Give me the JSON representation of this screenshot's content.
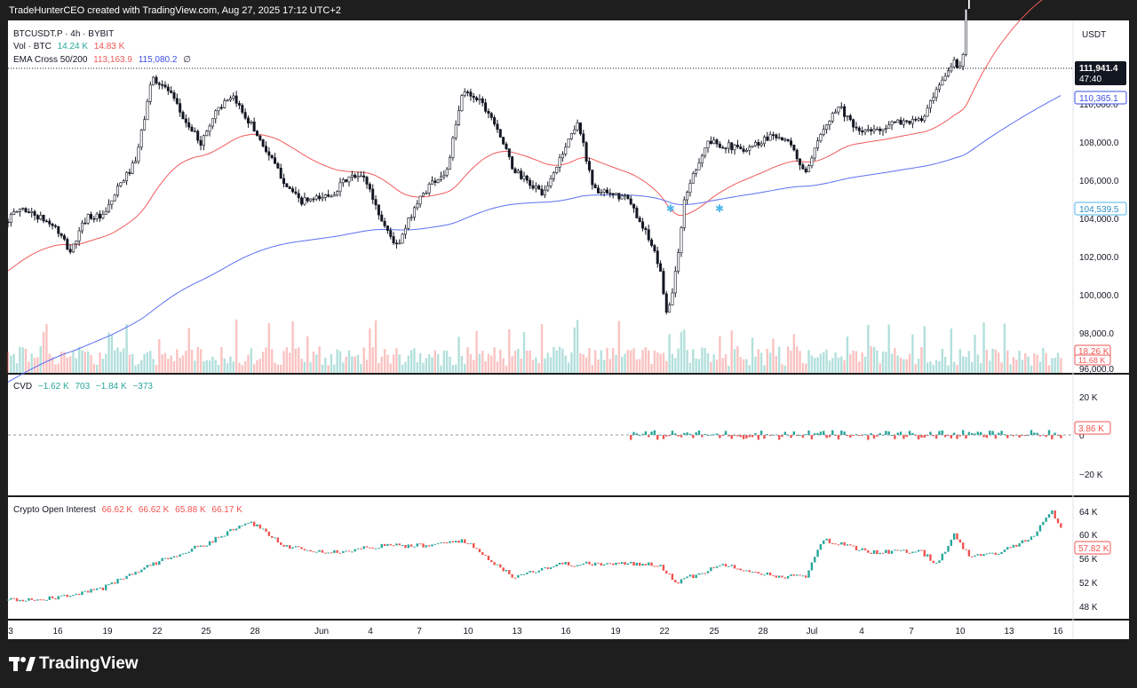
{
  "header": {
    "credit": "TradeHunterCEO created with TradingView.com, Aug 27, 2025 17:12 UTC+2"
  },
  "brand": {
    "name": "TradingView",
    "icon": "tradingview-logo-icon"
  },
  "legend": {
    "symbol": "BTCUSDT.P · 4h · BYBIT",
    "vol_label": "Vol · BTC",
    "vol_val1": "14.24 K",
    "vol_val2": "14.83 K",
    "ema_label": "EMA Cross 50/200",
    "ema_val1": "113,163.9",
    "ema_val2": "115,080.2",
    "ema_suffix": "∅",
    "cvd_label": "CVD",
    "cvd_vals": [
      "−1.62 K",
      "703",
      "−1.84 K",
      "−373"
    ],
    "oi_label": "Crypto Open Interest",
    "oi_vals": [
      "66.62 K",
      "66.62 K",
      "65.88 K",
      "66.17 K"
    ]
  },
  "axis": {
    "currency": "USDT",
    "price_ticks": [
      "110,000.0",
      "108,000.0",
      "106,000.0",
      "104,000.0",
      "102,000.0",
      "100,000.0",
      "98,000.0",
      "96,000.0"
    ],
    "cvd_ticks": [
      "20 K",
      "0",
      "−20 K"
    ],
    "oi_ticks": [
      "64 K",
      "60 K",
      "56 K",
      "52 K",
      "48 K"
    ],
    "date_ticks": [
      "3",
      "16",
      "19",
      "22",
      "25",
      "28",
      "Jun",
      "4",
      "7",
      "10",
      "13",
      "16",
      "19",
      "22",
      "25",
      "28",
      "Jul",
      "4",
      "7",
      "10",
      "13",
      "16"
    ],
    "labels": {
      "last_price": "111,941.4",
      "countdown": "47:40",
      "ema_fast": "110,365.1",
      "ema_slow": "104,539.5",
      "volume": "18.26 K",
      "volume_ma": "11.68 K",
      "cvd": "3.86 K",
      "oi": "57.82 K"
    }
  },
  "colors": {
    "up": "#26a69a",
    "down": "#ef5350",
    "ema_fast": "#f05a5a",
    "ema_slow": "#5b6ff2",
    "cross": "#4fb6e8",
    "candle": "#131722",
    "last_price_bg": "#131722"
  },
  "chart_data": [
    {
      "type": "candlestick",
      "title": "BTCUSDT.P · 4h · BYBIT",
      "ylim": [
        96000,
        113500
      ],
      "x_start": "May 13, 2025",
      "x_end": "Jul 17, 2025",
      "anchors": [
        [
          "May 13",
          103500
        ],
        [
          "May 14",
          104200
        ],
        [
          "May 16",
          103300
        ],
        [
          "May 17",
          102000
        ],
        [
          "May 18",
          103800
        ],
        [
          "May 19",
          103700
        ],
        [
          "May 20",
          105300
        ],
        [
          "May 21",
          106500
        ],
        [
          "May 22",
          110700
        ],
        [
          "May 23",
          110000
        ],
        [
          "May 24",
          108500
        ],
        [
          "May 25",
          107400
        ],
        [
          "May 26",
          109200
        ],
        [
          "May 27",
          109600
        ],
        [
          "May 28",
          108400
        ],
        [
          "May 29",
          107000
        ],
        [
          "May 30",
          105600
        ],
        [
          "May 31",
          104500
        ],
        [
          "Jun 1",
          104600
        ],
        [
          "Jun 2",
          104900
        ],
        [
          "Jun 3",
          105700
        ],
        [
          "Jun 4",
          105700
        ],
        [
          "Jun 5",
          103600
        ],
        [
          "Jun 6",
          102200
        ],
        [
          "Jun 7",
          104200
        ],
        [
          "Jun 8",
          105400
        ],
        [
          "Jun 9",
          106000
        ],
        [
          "Jun 10",
          110000
        ],
        [
          "Jun 11",
          109600
        ],
        [
          "Jun 12",
          108400
        ],
        [
          "Jun 13",
          106200
        ],
        [
          "Jun 14",
          105400
        ],
        [
          "Jun 15",
          104900
        ],
        [
          "Jun 16",
          106800
        ],
        [
          "Jun 17",
          108500
        ],
        [
          "Jun 18",
          105100
        ],
        [
          "Jun 19",
          104800
        ],
        [
          "Jun 20",
          104700
        ],
        [
          "Jun 21",
          103300
        ],
        [
          "Jun 22",
          101300
        ],
        [
          "Jun 22.5",
          98800
        ],
        [
          "Jun 23",
          101000
        ],
        [
          "Jun 23.5",
          104400
        ],
        [
          "Jun 24",
          105800
        ],
        [
          "Jun 25",
          107500
        ],
        [
          "Jun 26",
          107300
        ],
        [
          "Jun 27",
          107100
        ],
        [
          "Jun 28",
          107400
        ],
        [
          "Jun 29",
          107900
        ],
        [
          "Jun 30",
          107300
        ],
        [
          "Jul 1",
          105800
        ],
        [
          "Jul 2",
          108200
        ],
        [
          "Jul 3",
          109300
        ],
        [
          "Jul 4",
          108000
        ],
        [
          "Jul 5",
          108000
        ],
        [
          "Jul 6",
          108300
        ],
        [
          "Jul 7",
          108500
        ],
        [
          "Jul 8",
          108500
        ],
        [
          "Jul 9",
          110000
        ],
        [
          "Jul 10",
          111500
        ],
        [
          "Jul 10.5",
          111000
        ],
        [
          "Jul 11",
          117500
        ]
      ],
      "ema_cross_markers": [
        "Jun 22.5",
        "Jun 25.5"
      ],
      "last_price": 111941.4
    },
    {
      "type": "bar",
      "title": "Vol · BTC",
      "series": [
        {
          "name": "Vol · BTC",
          "values": [
            14.24,
            14.83
          ]
        }
      ],
      "last": 18.26,
      "ma": 11.68
    },
    {
      "type": "bar",
      "title": "CVD",
      "ylim": [
        -30,
        30
      ],
      "values": [
        -1.62,
        0.703,
        -1.84,
        -0.373
      ],
      "last": 3.86
    },
    {
      "type": "line",
      "title": "Crypto Open Interest",
      "ylim": [
        46,
        66
      ],
      "anchors": [
        [
          "May 13",
          49
        ],
        [
          "May 16",
          49.5
        ],
        [
          "May 19",
          51
        ],
        [
          "May 22",
          55
        ],
        [
          "May 25",
          58
        ],
        [
          "May 28",
          62
        ],
        [
          "May 30",
          58
        ],
        [
          "Jun 2",
          57
        ],
        [
          "Jun 5",
          58
        ],
        [
          "Jun 8",
          58
        ],
        [
          "Jun 10",
          59
        ],
        [
          "Jun 13",
          53
        ],
        [
          "Jun 16",
          55
        ],
        [
          "Jun 19",
          55
        ],
        [
          "Jun 22",
          55
        ],
        [
          "Jun 23",
          52
        ],
        [
          "Jun 26",
          55
        ],
        [
          "Jun 29",
          53
        ],
        [
          "Jul 1",
          53
        ],
        [
          "Jul 2",
          59
        ],
        [
          "Jul 5",
          57
        ],
        [
          "Jul 8",
          57
        ],
        [
          "Jul 9",
          55
        ],
        [
          "Jul 10",
          60
        ],
        [
          "Jul 11",
          56
        ],
        [
          "Jul 13",
          57
        ],
        [
          "Jul 15",
          60
        ],
        [
          "Jul 16",
          64
        ],
        [
          "Jul 17",
          57.82
        ]
      ],
      "last": 57.82
    }
  ]
}
